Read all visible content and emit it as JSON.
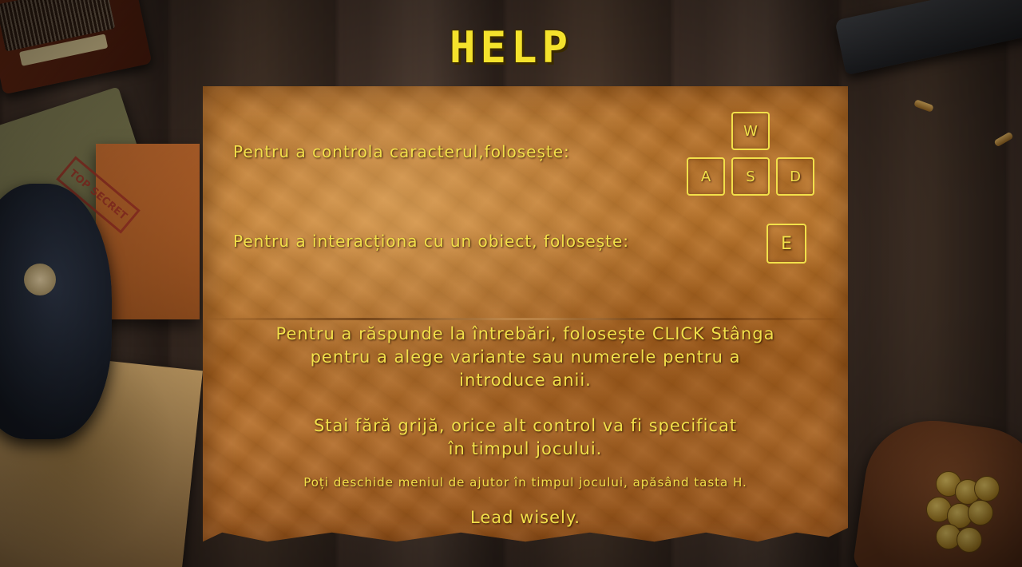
{
  "screen": {
    "title": "HELP"
  },
  "controls": {
    "movement_text": "Pentru a controla caracterul,folosește:",
    "movement_keys": {
      "up": "W",
      "left": "A",
      "down": "S",
      "right": "D"
    },
    "interact_text": "Pentru a interacționa cu un obiect, folosește:",
    "interact_key": "E"
  },
  "instructions": {
    "answers_line1": "Pentru a răspunde la întrebări, folosește CLICK Stânga",
    "answers_line2": "pentru a alege variante sau numerele pentru a",
    "answers_line3": "introduce anii.",
    "reassure_line1": "Stai fără grijă, orice alt control va fi specificat",
    "reassure_line2": "în timpul jocului.",
    "help_menu_note": "Poți deschide meniul de ajutor în timpul jocului, apăsând tasta H.",
    "closing": "Lead wisely."
  },
  "props": {
    "stamp_text": "TOP SECRET"
  },
  "colors": {
    "accent_text": "#f2e04a",
    "title": "#f4e22c",
    "paper": "#b06a22",
    "wood": "#3d2e25"
  }
}
